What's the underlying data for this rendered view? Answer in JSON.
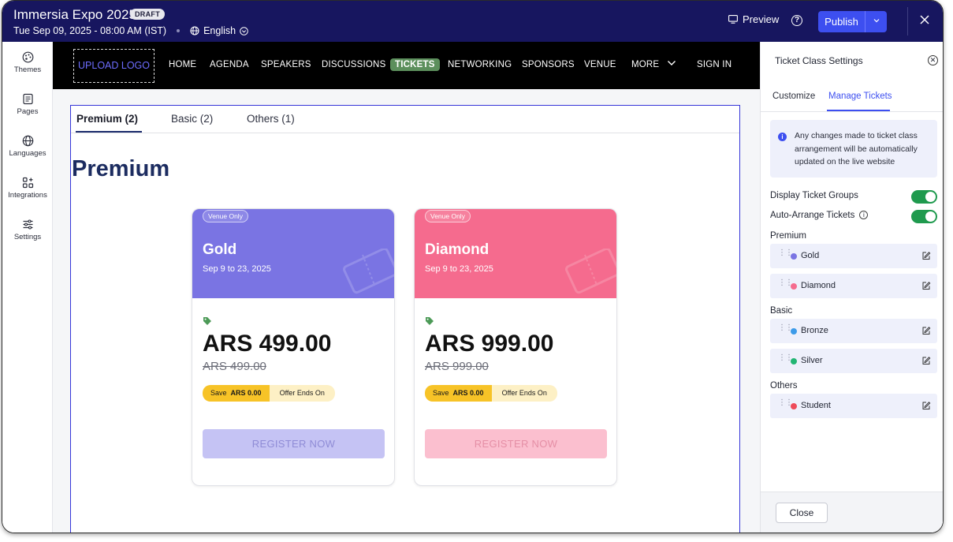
{
  "topbar": {
    "title": "Immersia Expo 2025",
    "status_badge": "DRAFT",
    "datetime": "Tue Sep 09, 2025 - 08:00 AM (IST)",
    "language": "English",
    "preview_label": "Preview",
    "publish_label": "Publish"
  },
  "leftrail": {
    "items": [
      {
        "label": "Themes",
        "icon": "palette-icon"
      },
      {
        "label": "Pages",
        "icon": "pages-icon"
      },
      {
        "label": "Languages",
        "icon": "globe-icon"
      },
      {
        "label": "Integrations",
        "icon": "integrations-icon"
      },
      {
        "label": "Settings",
        "icon": "sliders-icon"
      }
    ]
  },
  "site": {
    "upload_logo": "UPLOAD LOGO",
    "nav": [
      "HOME",
      "AGENDA",
      "SPEAKERS",
      "DISCUSSIONS",
      "TICKETS",
      "NETWORKING",
      "SPONSORS",
      "VENUE",
      "MORE",
      "SIGN IN"
    ],
    "active_nav": "TICKETS",
    "tabs": [
      "Premium (2)",
      "Basic (2)",
      "Others (1)"
    ],
    "section_title": "Premium",
    "cards": [
      {
        "badge": "Venue Only",
        "name": "Gold",
        "dates": "Sep 9 to 23, 2025",
        "price": "ARS 499.00",
        "old_price": "ARS 499.00",
        "save_text": "Save",
        "save_amount": "ARS 0.00",
        "offer_text": "Offer Ends On",
        "register_label": "REGISTER NOW",
        "head_color": "#7a74e3",
        "button_color": "#c5c3f4",
        "button_text_color": "#8f8cd6"
      },
      {
        "badge": "Venue Only",
        "name": "Diamond",
        "dates": "Sep 9 to 23, 2025",
        "price": "ARS 999.00",
        "old_price": "ARS 999.00",
        "save_text": "Save",
        "save_amount": "ARS 0.00",
        "offer_text": "Offer Ends On",
        "register_label": "REGISTER NOW",
        "head_color": "#f56b8e",
        "button_color": "#fbbfcf",
        "button_text_color": "#e58fa6"
      }
    ]
  },
  "panel": {
    "title": "Ticket Class Settings",
    "tabs": [
      "Customize",
      "Manage Tickets"
    ],
    "active_tab": "Manage Tickets",
    "info": "Any changes made to ticket class arrangement will be automatically updated on the live website",
    "toggles": [
      {
        "label": "Display Ticket Groups",
        "on": true
      },
      {
        "label": "Auto-Arrange Tickets",
        "on": true
      }
    ],
    "groups": [
      {
        "label": "Premium",
        "tickets": [
          {
            "name": "Gold",
            "color": "#7a74e3"
          },
          {
            "name": "Diamond",
            "color": "#f56b8e"
          }
        ]
      },
      {
        "label": "Basic",
        "tickets": [
          {
            "name": "Bronze",
            "color": "#3d9be9"
          },
          {
            "name": "Silver",
            "color": "#22b573"
          }
        ]
      },
      {
        "label": "Others",
        "tickets": [
          {
            "name": "Student",
            "color": "#ee4b5a"
          }
        ]
      }
    ],
    "close_label": "Close"
  },
  "colors": {
    "topbar_bg": "#17165f",
    "accent": "#3d4ff0",
    "toggle_on": "#1f9a4e",
    "active_nav_bg": "#5c8f5c"
  }
}
